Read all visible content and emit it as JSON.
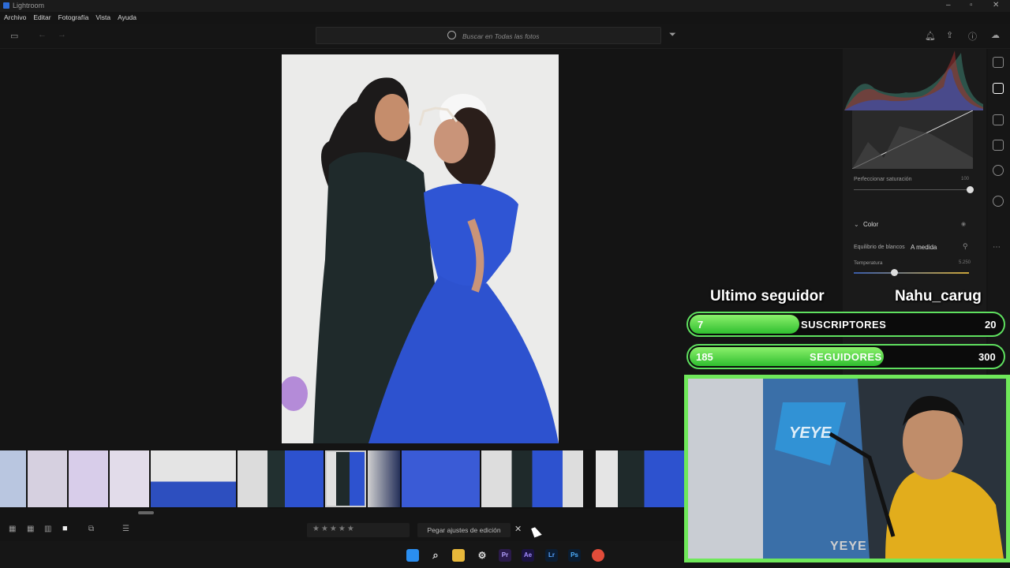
{
  "window": {
    "title": "Lightroom"
  },
  "menu": [
    "Archivo",
    "Editar",
    "Fotografía",
    "Vista",
    "Ayuda"
  ],
  "search": {
    "placeholder": "Buscar en Todas las fotos"
  },
  "edit_panel": {
    "refine_saturation_label": "Perfeccionar saturación",
    "refine_saturation_value": "100",
    "color_section": "Color",
    "white_balance_label": "Equilibrio de blancos",
    "white_balance_value": "A medida",
    "temperature_label": "Temperatura",
    "temperature_value": "5.250"
  },
  "bottom_bar": {
    "paste_label": "Pegar ajustes de edición",
    "stars": "★★★★★"
  },
  "overlay": {
    "last_follower_label": "Ultimo seguidor",
    "last_follower_name": "Nahu_carug",
    "subscribers_current": "7",
    "subscribers_label": "SUSCRIPTORES",
    "subscribers_goal": "20",
    "subscribers_progress": 0.35,
    "followers_current": "185",
    "followers_label": "SEGUIDORES",
    "followers_goal": "300",
    "followers_progress": 0.62,
    "cam_brand": "YEYE"
  },
  "taskbar_apps": [
    "Pr",
    "Ae",
    "Lr",
    "Ps"
  ],
  "colors": {
    "accent_green": "#5fe05f",
    "dress_blue": "#2f55d4",
    "lr_blue": "#2d6bd6"
  }
}
